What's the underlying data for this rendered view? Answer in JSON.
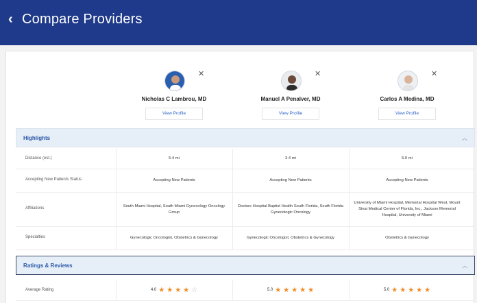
{
  "header": {
    "title": "Compare Providers",
    "back_icon": "chevron-left-icon"
  },
  "providers": [
    {
      "name": "Nicholas C Lambrou, MD",
      "view_profile": "View Profile",
      "remove_icon": "close-icon"
    },
    {
      "name": "Manuel A Penalver, MD",
      "view_profile": "View Profile",
      "remove_icon": "close-icon"
    },
    {
      "name": "Carlos A Medina, MD",
      "view_profile": "View Profile",
      "remove_icon": "close-icon"
    }
  ],
  "highlights": {
    "title": "Highlights",
    "rows": [
      {
        "label": "Distance (est.)",
        "values": [
          "5.4 mi",
          "3.4 mi",
          "5.0 mi"
        ]
      },
      {
        "label": "Accepting New Patients Status",
        "values": [
          "Accepting New Patients",
          "Accepting New Patients",
          "Accepting New Patients"
        ]
      },
      {
        "label": "Affiliations",
        "values": [
          "South Miami Hospital, South Miami Gynecology Oncology Group",
          "Doctors Hospital Baptist Health South Florida, South Florida Gynecologic Oncology",
          "University of Miami Hospital, Memorial Hospital West, Mount Sinai Medical Center of Florida, Inc., Jackson Memorial Hospital, University of Miami"
        ]
      },
      {
        "label": "Specialties",
        "values": [
          "Gynecologic Oncologist, Obstetrics & Gynecology",
          "Gynecologic Oncologist, Obstetrics & Gynecology",
          "Obstetrics & Gynecology"
        ]
      }
    ]
  },
  "ratings": {
    "title": "Ratings & Reviews",
    "row_label": "Average Rating",
    "values": [
      {
        "text": "4.0",
        "stars": 4
      },
      {
        "text": "5.0",
        "stars": 5
      },
      {
        "text": "5.0",
        "stars": 5
      }
    ]
  },
  "colors": {
    "header_bg": "#1f3a8a",
    "link": "#2b61c7",
    "star": "#f08a24",
    "section_bg": "#e6eef8"
  }
}
